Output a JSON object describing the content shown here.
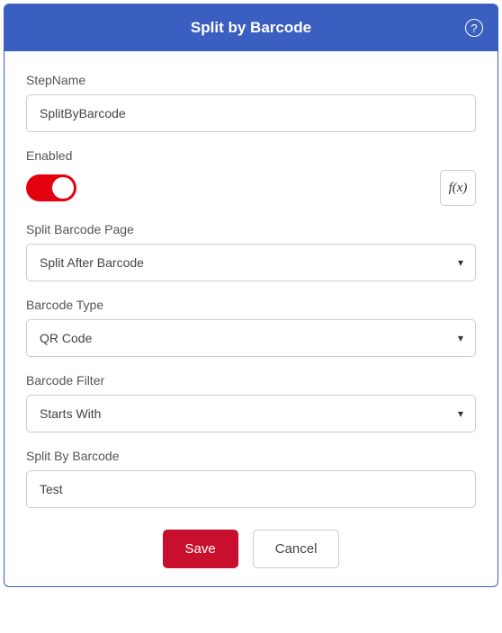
{
  "header": {
    "title": "Split by Barcode",
    "help_glyph": "?"
  },
  "fields": {
    "stepName": {
      "label": "StepName",
      "value": "SplitByBarcode"
    },
    "enabled": {
      "label": "Enabled",
      "fx_label": "f(x)"
    },
    "splitBarcodePage": {
      "label": "Split Barcode Page",
      "value": "Split After Barcode"
    },
    "barcodeType": {
      "label": "Barcode Type",
      "value": "QR Code"
    },
    "barcodeFilter": {
      "label": "Barcode Filter",
      "value": "Starts With"
    },
    "splitByBarcode": {
      "label": "Split By Barcode",
      "value": "Test"
    }
  },
  "actions": {
    "save": "Save",
    "cancel": "Cancel"
  },
  "glyphs": {
    "chevron_down": "▾"
  }
}
